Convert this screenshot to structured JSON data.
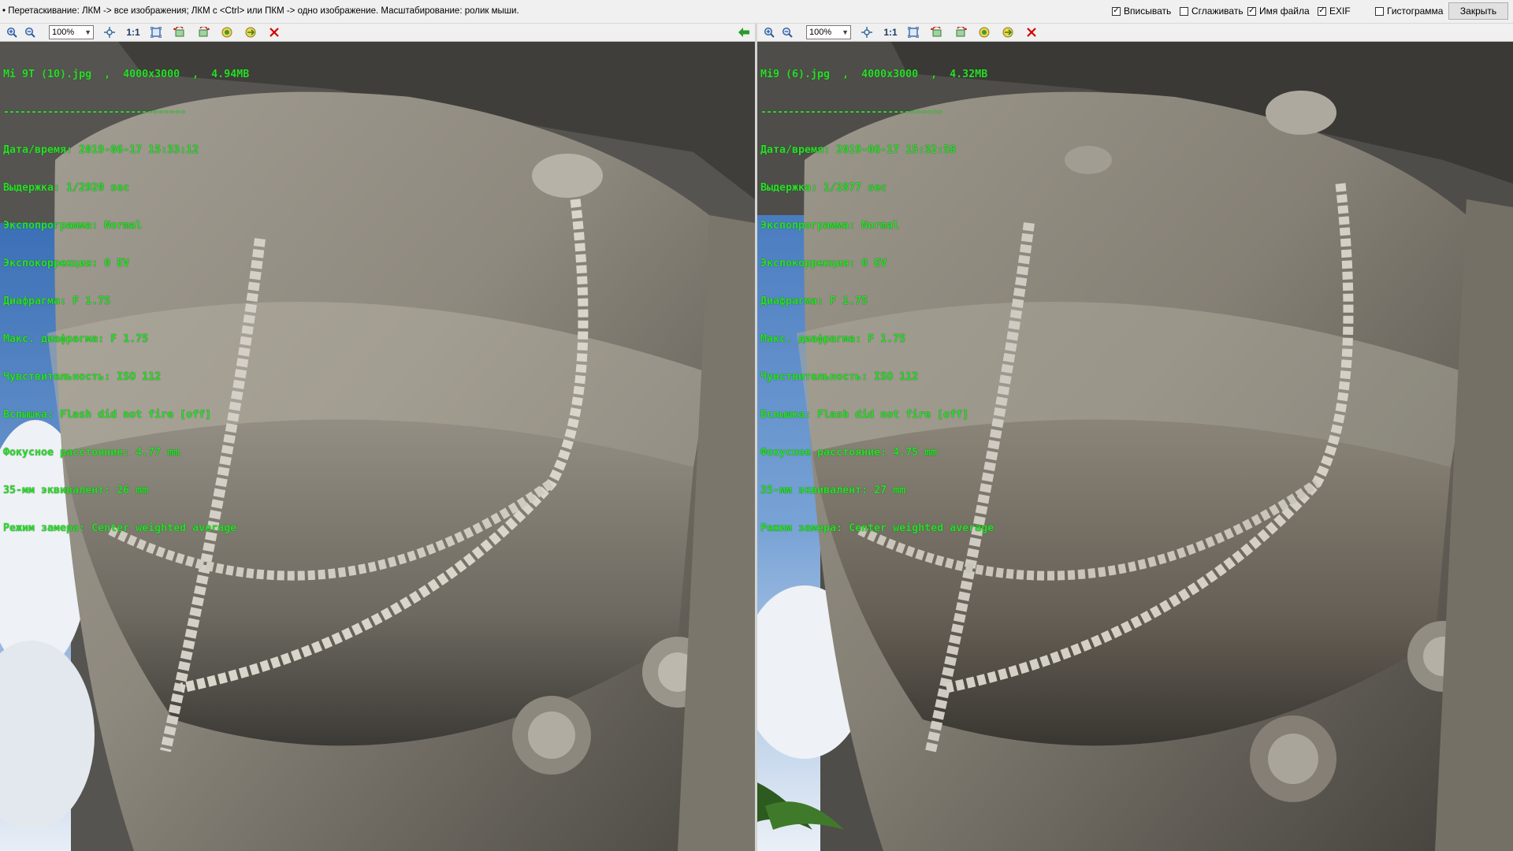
{
  "hint": "• Перетаскивание: ЛКМ -> все изображения; ЛКМ с <Ctrl> или ПКМ -> одно изображение. Масштабирование: ролик мыши.",
  "options": [
    {
      "label": "Вписывать",
      "checked": true
    },
    {
      "label": "Сглаживать",
      "checked": false
    },
    {
      "label": "Имя файла",
      "checked": true
    },
    {
      "label": "EXIF",
      "checked": true
    },
    {
      "label": "Гистограмма",
      "checked": false
    }
  ],
  "close_label": "Закрыть",
  "panes": {
    "left": {
      "zoom": "100%",
      "one_to_one": "1:1",
      "file": "Mi 9T (10).jpg  ,  4000x3000  ,  4.94MB",
      "separator": "---------------------------------",
      "exif": [
        "Дата/время: 2019-06-17 15:33:12",
        "Выдержка: 1/2920 sec",
        "Экспопрограмма: Normal",
        "Экспокоррекция: 0 EV",
        "Диафрагма: F 1.75",
        "Макс. диафрагма: F 1.75",
        "Чувствительность: ISO 112",
        "Вспышка: Flash did not fire [off]",
        "Фокусное расстояние: 4.77 mm",
        "35-мм эквивалент: 26 mm",
        "Режим замера: Center weighted average"
      ]
    },
    "right": {
      "zoom": "100%",
      "one_to_one": "1:1",
      "file": "Mi9 (6).jpg  ,  4000x3000  ,  4.32MB",
      "separator": "---------------------------------",
      "exif": [
        "Дата/время: 2019-06-17 15:32:58",
        "Выдержка: 1/2877 sec",
        "Экспопрограмма: Normal",
        "Экспокоррекция: 0 EV",
        "Диафрагма: F 1.75",
        "Макс. диафрагма: F 1.75",
        "Чувствительность: ISO 112",
        "Вспышка: Flash did not fire [off]",
        "Фокусное расстояние: 4.75 mm",
        "35-мм эквивалент: 27 mm",
        "Режим замера: Center weighted average"
      ]
    }
  },
  "icons": [
    "zoom-in-icon",
    "zoom-out-icon",
    "fit-icon",
    "actual-size-icon",
    "fullscreen-icon",
    "rotate-left-icon",
    "rotate-right-icon",
    "flip-icon",
    "save-icon",
    "close-icon",
    "sync-arrow-icon"
  ],
  "colors": {
    "exif_text": "#2bdc2b",
    "close_red": "#d40000",
    "arrow_green": "#2a9a2a"
  }
}
